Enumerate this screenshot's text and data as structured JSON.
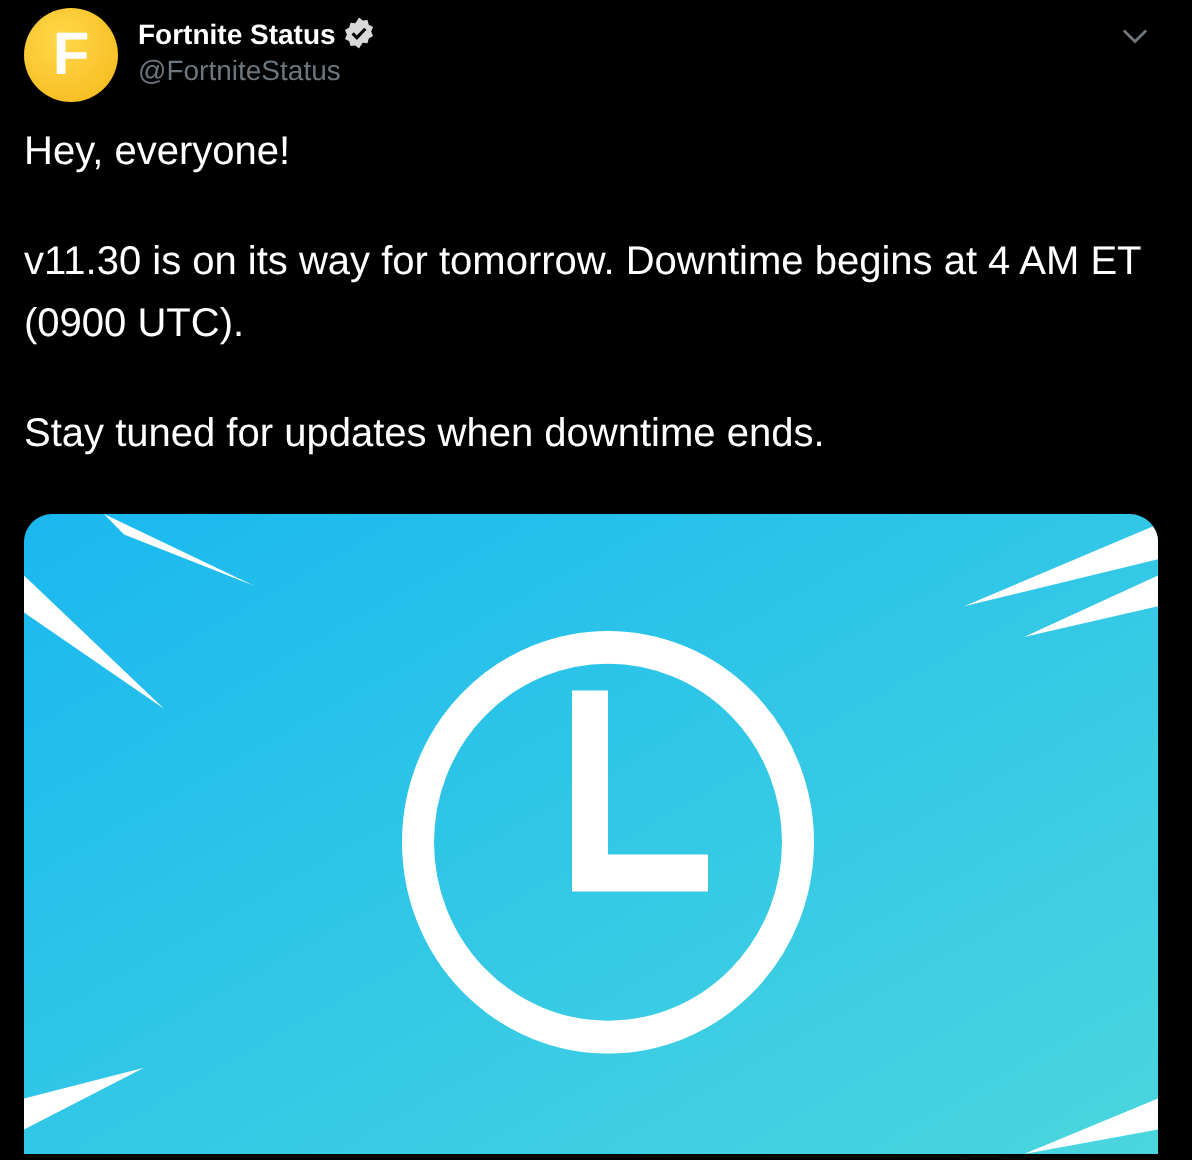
{
  "author": {
    "avatar_letter": "F",
    "name": "Fortnite Status",
    "verified": true,
    "handle": "@FortniteStatus"
  },
  "paragraphs": [
    "Hey, everyone!",
    "v11.30 is on its way for tomorrow. Downtime begins at 4 AM ET (0900 UTC).",
    "Stay tuned for updates when downtime ends."
  ]
}
